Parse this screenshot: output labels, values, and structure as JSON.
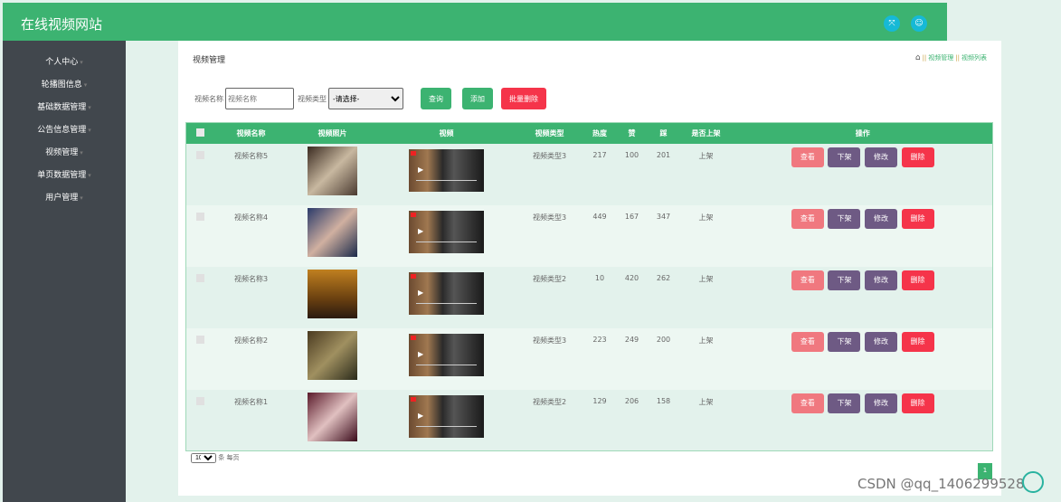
{
  "header": {
    "title": "在线视频网站",
    "icons": [
      "fullscreen-icon",
      "user-icon"
    ]
  },
  "sidebar": {
    "items": [
      {
        "label": "个人中心"
      },
      {
        "label": "轮播图信息"
      },
      {
        "label": "基础数据管理"
      },
      {
        "label": "公告信息管理"
      },
      {
        "label": "视频管理"
      },
      {
        "label": "单页数据管理"
      },
      {
        "label": "用户管理"
      }
    ]
  },
  "page": {
    "title": "视频管理",
    "breadcrumb": [
      "视频管理",
      "视频列表"
    ]
  },
  "search": {
    "name_label": "视频名称",
    "name_placeholder": "视频名称",
    "type_label": "视频类型",
    "type_selected": "-请选择-",
    "query": "查询",
    "add": "添加",
    "batch_delete": "批量删除"
  },
  "colors": {
    "green": "#3cb371",
    "view": "#f0787f",
    "purple": "#6e5a84",
    "delete": "#f5344a"
  },
  "table": {
    "headers": [
      "视频名称",
      "视频照片",
      "视频",
      "视频类型",
      "热度",
      "赞",
      "踩",
      "是否上架",
      "操作"
    ],
    "rows": [
      {
        "name": "视频名称5",
        "type": "视频类型3",
        "hot": "217",
        "like": "100",
        "dislike": "201",
        "status": "上架"
      },
      {
        "name": "视频名称4",
        "type": "视频类型3",
        "hot": "449",
        "like": "167",
        "dislike": "347",
        "status": "上架"
      },
      {
        "name": "视频名称3",
        "type": "视频类型2",
        "hot": "10",
        "like": "420",
        "dislike": "262",
        "status": "上架"
      },
      {
        "name": "视频名称2",
        "type": "视频类型3",
        "hot": "223",
        "like": "249",
        "dislike": "200",
        "status": "上架"
      },
      {
        "name": "视频名称1",
        "type": "视频类型2",
        "hot": "129",
        "like": "206",
        "dislike": "158",
        "status": "上架"
      }
    ],
    "actions": {
      "view": "查看",
      "unshelve": "下架",
      "edit": "修改",
      "delete": "删除"
    }
  },
  "pagination": {
    "page_size": "10",
    "per_page_label": "条 每页",
    "current_page": "1"
  },
  "watermark": "CSDN @qq_1406299528"
}
